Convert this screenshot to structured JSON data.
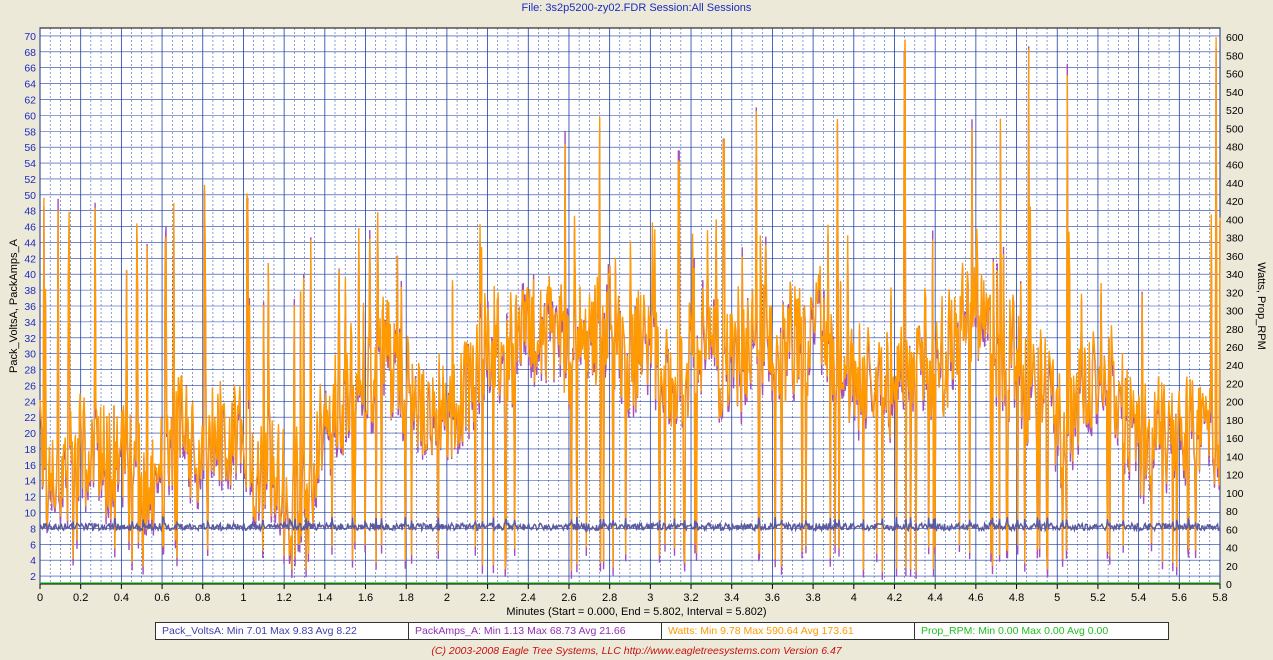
{
  "header": {
    "title": "File: 3s2p5200-zy02.FDR   Session:All Sessions"
  },
  "chart_data": {
    "type": "line",
    "xlabel": "Minutes (Start = 0.000,  End = 5.802,  Interval = 5.802)",
    "ylabel_left": "Pack_VoltsA, PackAmps_A",
    "ylabel_right": "Watts, Prop_RPM",
    "xlim": [
      0,
      5.8
    ],
    "ylim_left": [
      1,
      71
    ],
    "ylim_right": [
      0,
      610
    ],
    "x_ticks": [
      "0",
      "0.2",
      "0.4",
      "0.6",
      "0.8",
      "1",
      "1.2",
      "1.4",
      "1.6",
      "1.8",
      "2",
      "2.2",
      "2.4",
      "2.6",
      "2.8",
      "3",
      "3.2",
      "3.4",
      "3.6",
      "3.8",
      "4",
      "4.2",
      "4.4",
      "4.6",
      "4.8",
      "5",
      "5.2",
      "5.4",
      "5.6",
      "5.8"
    ],
    "y_ticks_left": [
      "2",
      "4",
      "6",
      "8",
      "10",
      "12",
      "14",
      "16",
      "18",
      "20",
      "22",
      "24",
      "26",
      "28",
      "30",
      "32",
      "34",
      "36",
      "38",
      "40",
      "42",
      "44",
      "46",
      "48",
      "50",
      "52",
      "54",
      "56",
      "58",
      "60",
      "62",
      "64",
      "66",
      "68",
      "70"
    ],
    "y_ticks_right": [
      "0",
      "20",
      "40",
      "60",
      "80",
      "100",
      "120",
      "140",
      "160",
      "180",
      "200",
      "220",
      "240",
      "260",
      "280",
      "300",
      "320",
      "340",
      "360",
      "380",
      "400",
      "420",
      "440",
      "460",
      "480",
      "500",
      "520",
      "540",
      "560",
      "580",
      "600"
    ],
    "grid": true,
    "series": [
      {
        "name": "Pack_VoltsA",
        "axis": "left",
        "color": "#5a5aa0",
        "min": 7.01,
        "max": 9.83,
        "avg": 8.22
      },
      {
        "name": "PackAmps_A",
        "axis": "left",
        "color": "#a050c0",
        "min": 1.13,
        "max": 68.73,
        "avg": 21.66
      },
      {
        "name": "Watts",
        "axis": "right",
        "color": "#ff9a00",
        "min": 9.78,
        "max": 590.64,
        "avg": 173.61
      },
      {
        "name": "Prop_RPM",
        "axis": "right",
        "color": "#20c020",
        "min": 0.0,
        "max": 0.0,
        "avg": 0.0
      }
    ],
    "peaks": [
      {
        "x": 0.02,
        "amps": 48.5
      },
      {
        "x": 0.09,
        "amps": 49.5
      },
      {
        "x": 0.27,
        "amps": 49
      },
      {
        "x": 0.81,
        "amps": 50.5
      },
      {
        "x": 1.02,
        "amps": 49.5
      },
      {
        "x": 2.58,
        "amps": 58
      },
      {
        "x": 2.75,
        "amps": 58.5
      },
      {
        "x": 3.14,
        "amps": 55.5
      },
      {
        "x": 3.36,
        "amps": 57
      },
      {
        "x": 3.52,
        "amps": 61
      },
      {
        "x": 3.92,
        "amps": 59
      },
      {
        "x": 4.25,
        "amps": 68
      },
      {
        "x": 4.58,
        "amps": 59.5
      },
      {
        "x": 4.72,
        "amps": 58
      },
      {
        "x": 4.86,
        "amps": 68.7
      },
      {
        "x": 5.05,
        "amps": 66.5
      },
      {
        "x": 5.78,
        "amps": 68.5
      }
    ]
  },
  "legend": [
    {
      "name": "Pack_VoltsA:",
      "min_label": "Min 7.01",
      "max_label": "Max 9.83",
      "avg_label": "Avg 8.22",
      "color": "#4040b0"
    },
    {
      "name": "PackAmps_A:",
      "min_label": "Min 1.13",
      "max_label": "Max 68.73",
      "avg_label": "Avg 21.66",
      "color": "#9030b0"
    },
    {
      "name": "Watts:",
      "min_label": "Min 9.78",
      "max_label": "Max 590.64",
      "avg_label": "Avg 173.61",
      "color": "#ff9a00"
    },
    {
      "name": "Prop_RPM:",
      "min_label": "Min 0.00",
      "max_label": "Max 0.00",
      "avg_label": "Avg 0.00",
      "color": "#20c020"
    }
  ],
  "footer": {
    "copyright": "(C) 2003-2008 Eagle Tree Systems, LLC      http://www.eagletreesystems.com      Version 6.47"
  }
}
